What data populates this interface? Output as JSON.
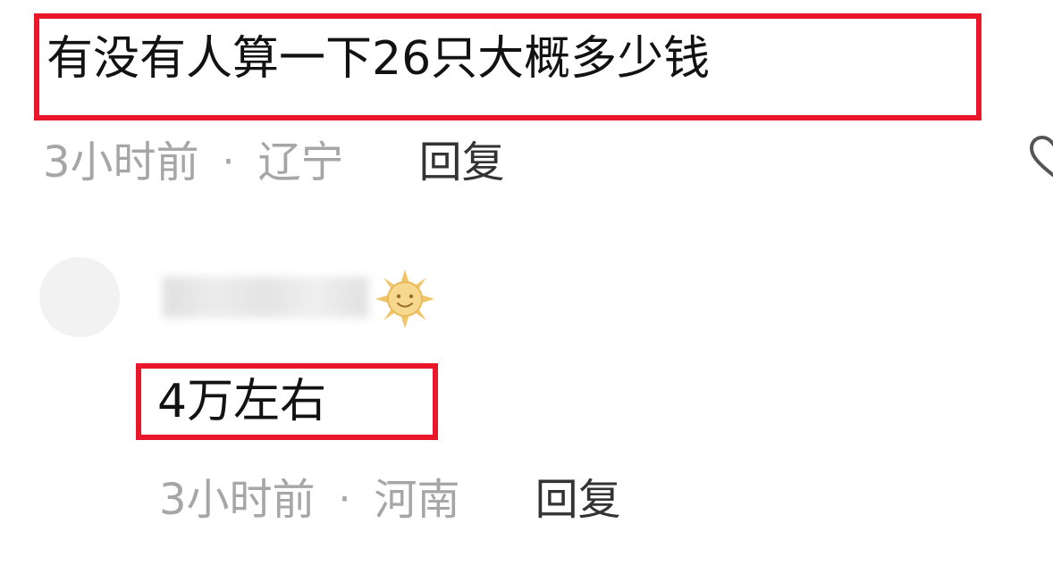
{
  "top_comment": {
    "text": "有没有人算一下26只大概多少钱",
    "time": "3小时前",
    "separator": "·",
    "location": "辽宁",
    "reply_label": "回复"
  },
  "reply_comment": {
    "username": "",
    "badge_icon": "sun-badge-icon",
    "text": "4万左右",
    "time": "3小时前",
    "separator": "·",
    "location": "河南",
    "reply_label": "回复"
  },
  "colors": {
    "highlight_border": "#e8182a",
    "primary_text": "#121212",
    "meta_text": "#a6a6a6",
    "reply_text": "#333333"
  }
}
